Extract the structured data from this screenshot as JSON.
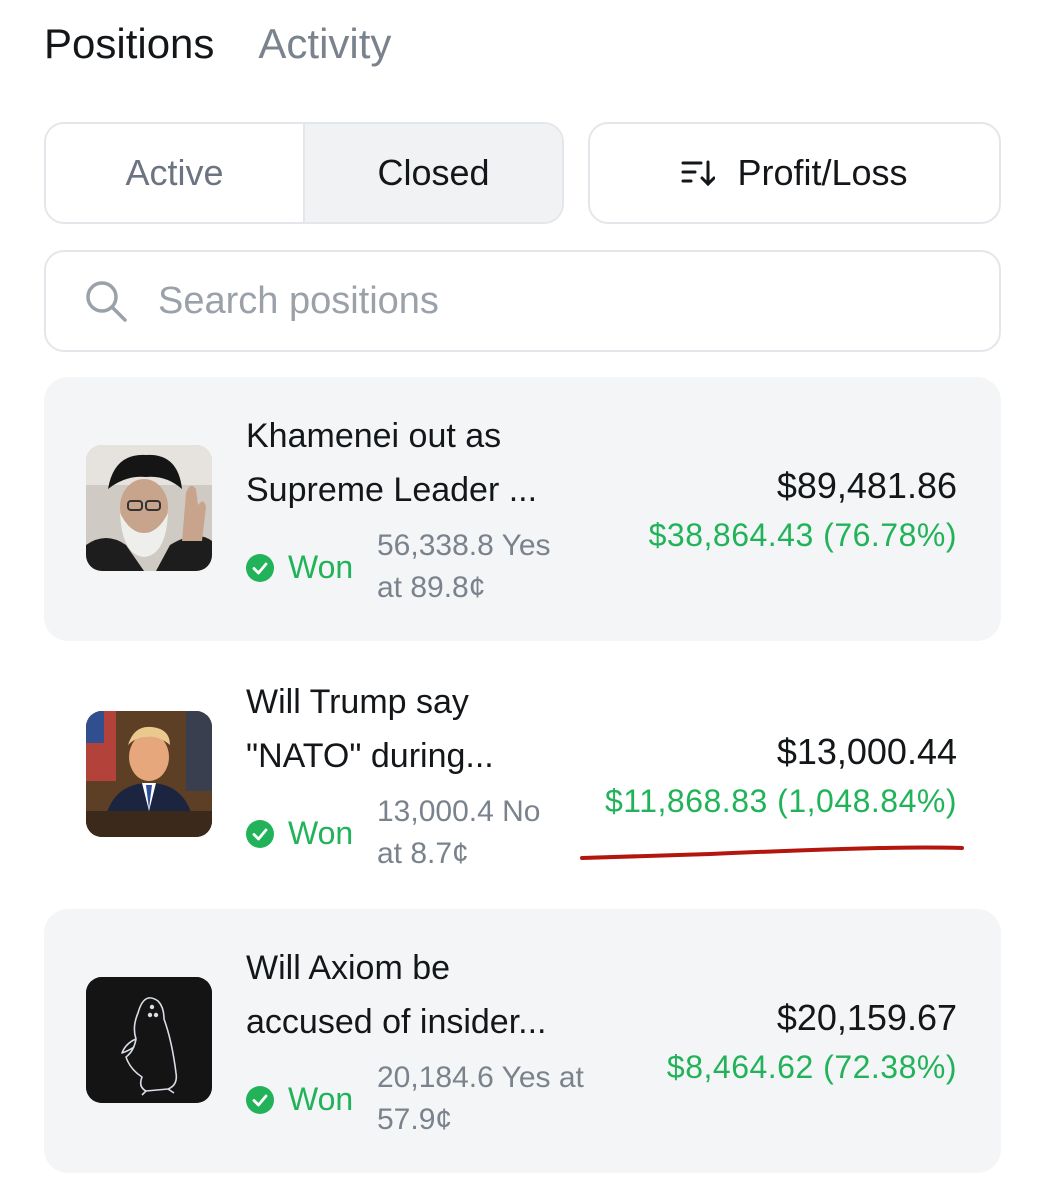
{
  "tabs": {
    "positions": "Positions",
    "activity": "Activity"
  },
  "filter": {
    "active": "Active",
    "closed": "Closed",
    "sort_label": "Profit/Loss"
  },
  "search": {
    "placeholder": "Search positions"
  },
  "colors": {
    "green": "#22b35a",
    "annotation_red": "#b3160c"
  },
  "positions": [
    {
      "title_line1": "Khamenei out as",
      "title_line2": "Supreme Leader ...",
      "status": "Won",
      "shares_line1": "56,338.8 Yes",
      "shares_line2": "at 89.8¢",
      "value": "$89,481.86",
      "pnl": "$38,864.43 (76.78%)"
    },
    {
      "title_line1": "Will Trump say",
      "title_line2": "\"NATO\" during...",
      "status": "Won",
      "shares_line1": "13,000.4 No",
      "shares_line2": "at 8.7¢",
      "value": "$13,000.44",
      "pnl": "$11,868.83 (1,048.84%)"
    },
    {
      "title_line1": "Will Axiom be",
      "title_line2": "accused of insider...",
      "status": "Won",
      "shares_line1": "20,184.6 Yes at",
      "shares_line2": "57.9¢",
      "value": "$20,159.67",
      "pnl": "$8,464.62 (72.38%)"
    }
  ]
}
